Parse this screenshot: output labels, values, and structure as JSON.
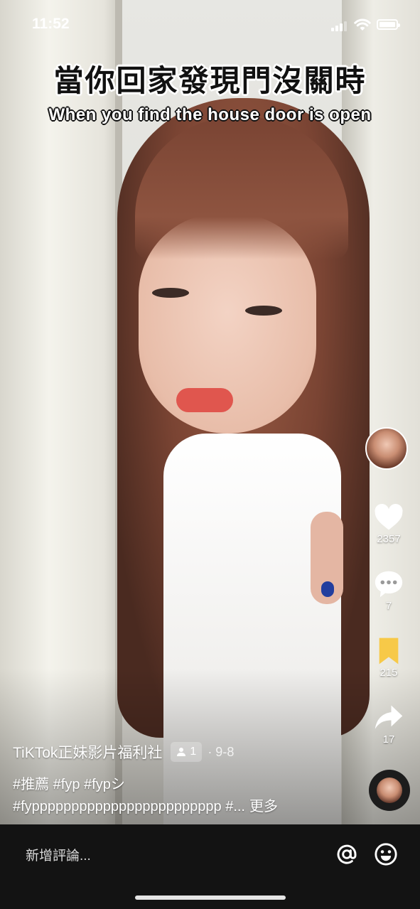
{
  "status_bar": {
    "time": "11:52",
    "icons": [
      "signal-icon",
      "wifi-icon",
      "battery-icon"
    ]
  },
  "video": {
    "caption_zh": "當你回家發現門沒關時",
    "caption_en": "When you find the house door is open"
  },
  "actions": {
    "likes": "2357",
    "comments": "7",
    "saves": "215",
    "shares": "17",
    "icons": [
      "heart-icon",
      "comment-icon",
      "bookmark-icon",
      "share-icon"
    ],
    "save_color": "#F7C948"
  },
  "post": {
    "author": "TiKTok正妹影片福利社",
    "collab_count": "1",
    "date": "· 9-8",
    "hashtags_line1": "#推薦 #fyp #fypシ",
    "hashtags_line2": "#fypppppppppppppppppppppppp #...",
    "more_label": "更多"
  },
  "comment_bar": {
    "placeholder": "新增評論..."
  }
}
